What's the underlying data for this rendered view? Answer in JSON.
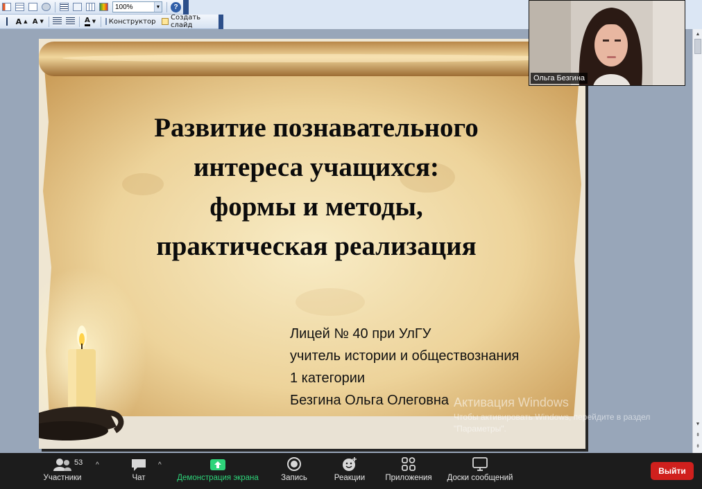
{
  "toolbar": {
    "zoom_value": "100%",
    "help_label": "?",
    "font_grow_label": "A",
    "font_shrink_label": "A",
    "font_color_label": "A",
    "designer_label": "Конструктор",
    "new_slide_label": "Создать слайд"
  },
  "slide": {
    "title_lines": [
      "Развитие познавательного",
      "интереса учащихся:",
      "формы и методы,",
      "практическая реализация"
    ],
    "author_lines": [
      "Лицей № 40 при УлГУ",
      "учитель истории и обществознания",
      "1 категории",
      "Безгина Ольга Олеговна"
    ]
  },
  "activation": {
    "title": "Активация Windows",
    "text": "Чтобы активировать Windows, перейдите в раздел \"Параметры\"."
  },
  "participant_video": {
    "name": "Ольга Безгина"
  },
  "zoom_bar": {
    "participants_label": "Участники",
    "participants_count": "53",
    "chat_label": "Чат",
    "share_label": "Демонстрация экрана",
    "record_label": "Запись",
    "reactions_label": "Реакции",
    "apps_label": "Приложения",
    "whiteboard_label": "Доски сообщений",
    "leave_label": "Выйти",
    "share_color": "#2ed47a",
    "leave_color": "#d0201d"
  },
  "icons": [
    "participants-icon",
    "chat-icon",
    "share-screen-icon",
    "record-icon",
    "reactions-icon",
    "apps-icon",
    "whiteboard-icon"
  ]
}
